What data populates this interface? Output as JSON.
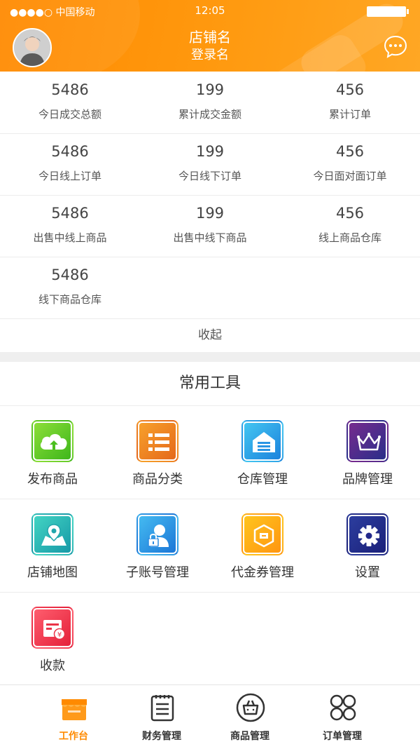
{
  "status_bar": {
    "carrier": "●●●●○ 中国移动",
    "time": "12:05"
  },
  "header": {
    "store_name": "店铺名",
    "login_name": "登录名"
  },
  "stats": [
    {
      "value": "5486",
      "label": "今日成交总额"
    },
    {
      "value": "199",
      "label": "累计成交金额"
    },
    {
      "value": "456",
      "label": "累计订单"
    },
    {
      "value": "5486",
      "label": "今日线上订单"
    },
    {
      "value": "199",
      "label": "今日线下订单"
    },
    {
      "value": "456",
      "label": "今日面对面订单"
    },
    {
      "value": "5486",
      "label": "出售中线上商品"
    },
    {
      "value": "199",
      "label": "出售中线下商品"
    },
    {
      "value": "456",
      "label": "线上商品仓库"
    },
    {
      "value": "5486",
      "label": "线下商品仓库"
    }
  ],
  "collapse_label": "收起",
  "tools": {
    "title": "常用工具",
    "items": [
      {
        "label": "发布商品",
        "icon": "cloud-upload-icon",
        "color1": "#7ed321",
        "color2": "#3fb618"
      },
      {
        "label": "商品分类",
        "icon": "list-icon",
        "color1": "#f59a23",
        "color2": "#e06b1a"
      },
      {
        "label": "仓库管理",
        "icon": "warehouse-icon",
        "color1": "#3ec1f0",
        "color2": "#1a86e0"
      },
      {
        "label": "品牌管理",
        "icon": "crown-icon",
        "color1": "#6b2a8c",
        "color2": "#2b2f8a"
      },
      {
        "label": "店铺地图",
        "icon": "map-pin-icon",
        "color1": "#3fd0c0",
        "color2": "#1aa0a8"
      },
      {
        "label": "子账号管理",
        "icon": "user-lock-icon",
        "color1": "#3eb4f0",
        "color2": "#1a78d8"
      },
      {
        "label": "代金券管理",
        "icon": "coupon-icon",
        "color1": "#ffc21a",
        "color2": "#ff9a10"
      },
      {
        "label": "设置",
        "icon": "gear-icon",
        "color1": "#2a3a9a",
        "color2": "#1a2078"
      },
      {
        "label": "收款",
        "icon": "receipt-icon",
        "color1": "#ff5a6a",
        "color2": "#e8213a"
      }
    ]
  },
  "tabbar": [
    {
      "label": "工作台",
      "icon": "store-icon",
      "active": true
    },
    {
      "label": "财务管理",
      "icon": "clipboard-icon",
      "active": false
    },
    {
      "label": "商品管理",
      "icon": "shopping-bag-icon",
      "active": false
    },
    {
      "label": "订单管理",
      "icon": "grid-icon",
      "active": false
    }
  ],
  "colors": {
    "accent": "#ff8a00"
  }
}
